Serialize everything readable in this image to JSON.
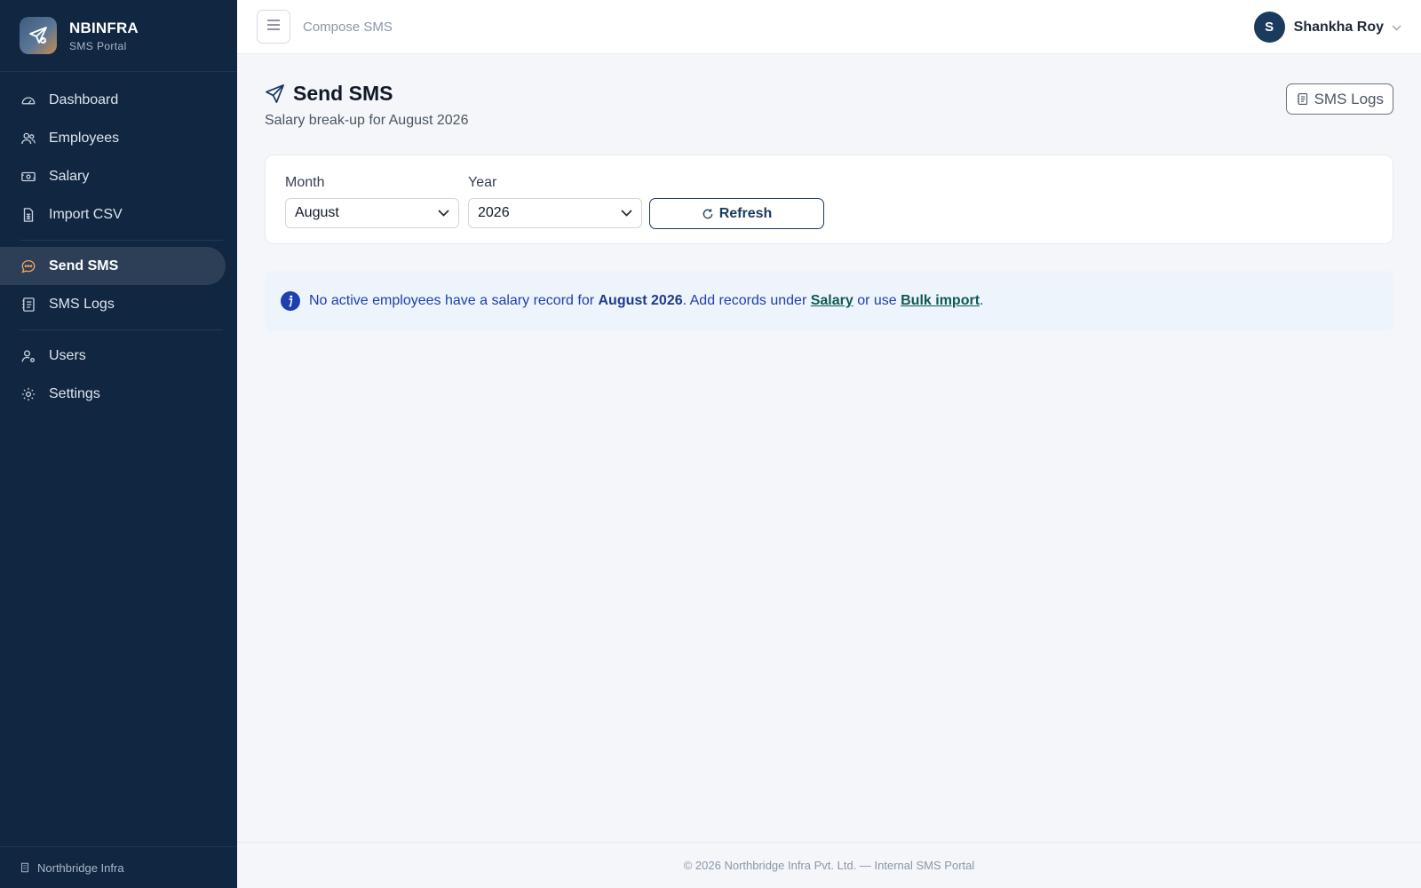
{
  "brand": {
    "name": "NBINFRA",
    "subtitle": "SMS Portal",
    "logo_icon": "paper-plane-check-icon"
  },
  "sidebar": {
    "items": [
      {
        "label": "Dashboard",
        "icon": "gauge-icon"
      },
      {
        "label": "Employees",
        "icon": "users-icon"
      },
      {
        "label": "Salary",
        "icon": "cash-icon"
      },
      {
        "label": "Import CSV",
        "icon": "file-spreadsheet-icon"
      },
      {
        "label": "Send SMS",
        "icon": "chat-dots-icon",
        "active": true
      },
      {
        "label": "SMS Logs",
        "icon": "journal-icon"
      },
      {
        "label": "Users",
        "icon": "person-gear-icon"
      },
      {
        "label": "Settings",
        "icon": "gear-icon"
      }
    ],
    "footer": "Northbridge Infra"
  },
  "topbar": {
    "breadcrumb": "Compose SMS",
    "user_initial": "S",
    "user_name": "Shankha Roy"
  },
  "page": {
    "title": "Send SMS",
    "subtitle": "Salary break-up for August 2026",
    "logs_button": "SMS Logs"
  },
  "filters": {
    "month_label": "Month",
    "month_value": "August",
    "year_label": "Year",
    "year_value": "2026",
    "refresh_label": "Refresh"
  },
  "alert": {
    "text_1": "No active employees have a salary record for ",
    "period": "August 2026",
    "text_2": ". Add records under ",
    "link_salary": "Salary",
    "text_3": " or use ",
    "link_bulk": "Bulk import",
    "text_4": "."
  },
  "footer": "© 2026 Northbridge Infra Pvt. Ltd. — Internal SMS Portal",
  "colors": {
    "sidebar_bg": "#112640",
    "accent": "#1a3a5e",
    "alert_bg": "#eef4fc",
    "link": "#0f5a52"
  }
}
